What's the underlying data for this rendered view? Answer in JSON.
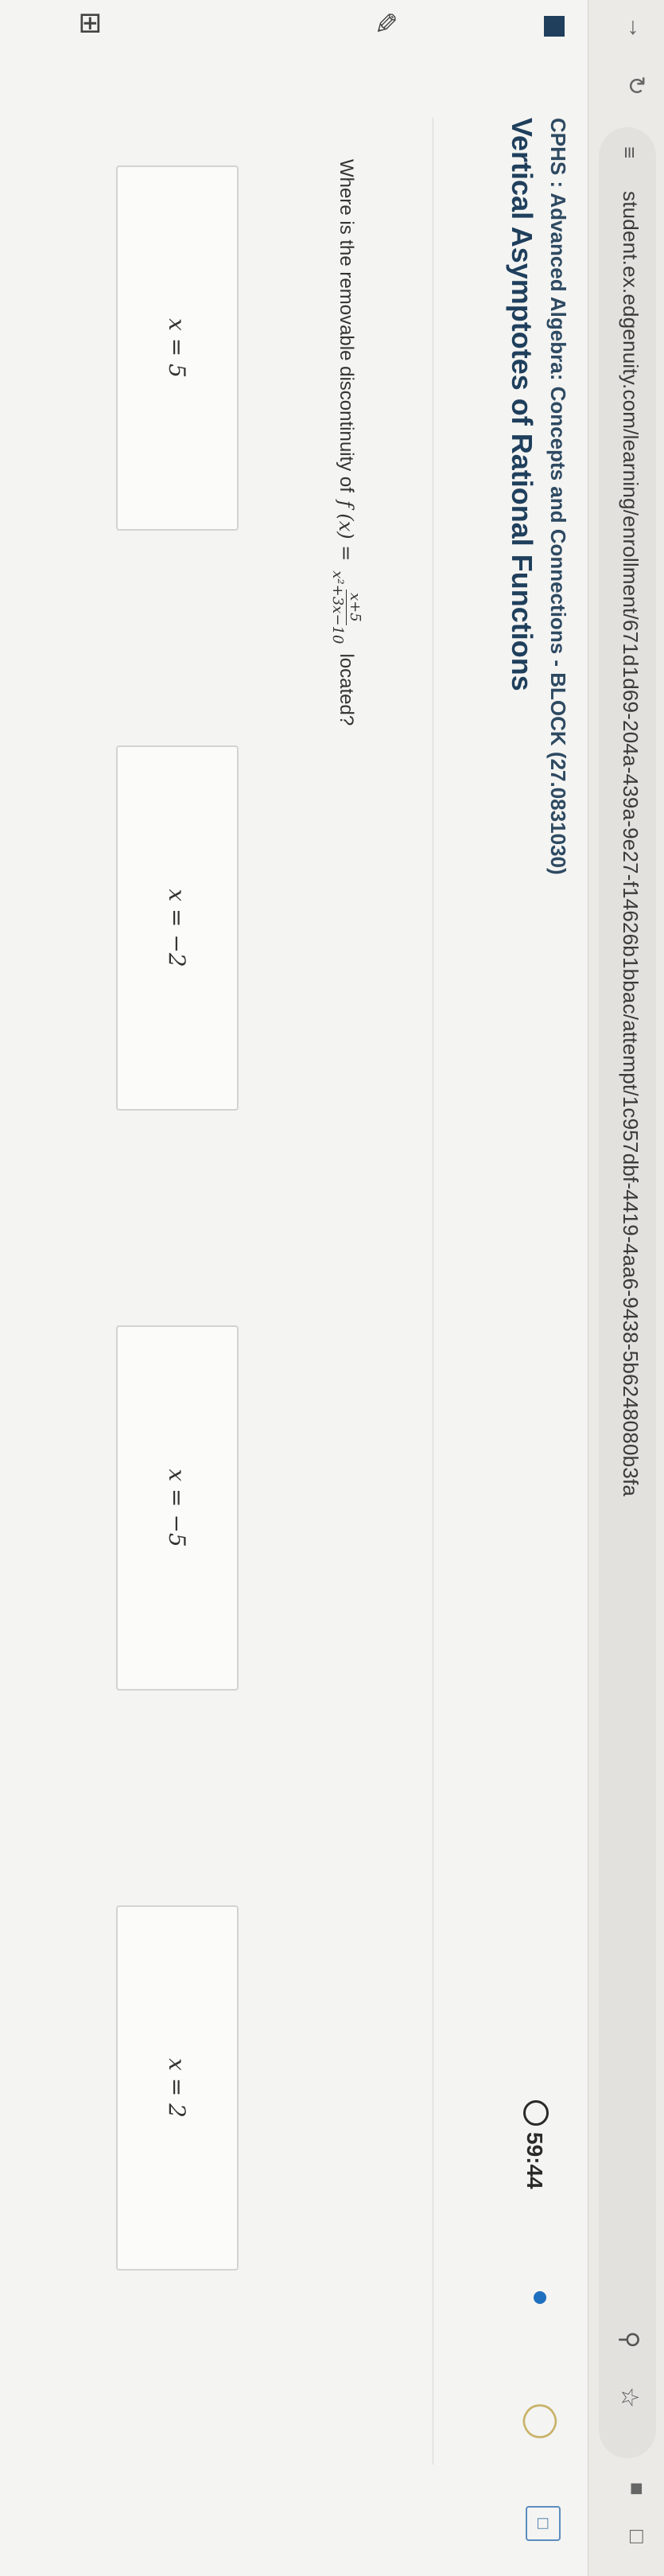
{
  "browser": {
    "url": "student.ex.edgenuity.com/learning/enrollment/671d1d69-204a-439a-9e27-f14626b1bbac/attempt/1c957dbf-4419-4aa6-9438-5b6248080b3fa"
  },
  "header": {
    "breadcrumb": "CPHS : Advanced Algebra: Concepts and Connections - BLOCK (27.0831030)",
    "title": "Vertical Asymptotes of Rational Functions",
    "timer": "59:44"
  },
  "question": {
    "prefix": "Where is the removable discontinuity of",
    "function_lhs": "f (x) =",
    "numerator": "x+5",
    "denominator": "x²+3x−10",
    "suffix": "located?"
  },
  "choices": [
    {
      "label": "x = 5"
    },
    {
      "label": "x = −2"
    },
    {
      "label": "x = −5"
    },
    {
      "label": "x = 2"
    }
  ],
  "colors": {
    "title": "#1f3f5c",
    "accent": "#1f6fbf"
  },
  "icons": [
    "back-arrow-icon",
    "reload-icon",
    "site-settings-icon",
    "zoom-icon",
    "bookmark-star-icon",
    "extension-icon",
    "sidebar-icon",
    "timer-icon",
    "hint-bulb-icon",
    "calculator-icon"
  ]
}
